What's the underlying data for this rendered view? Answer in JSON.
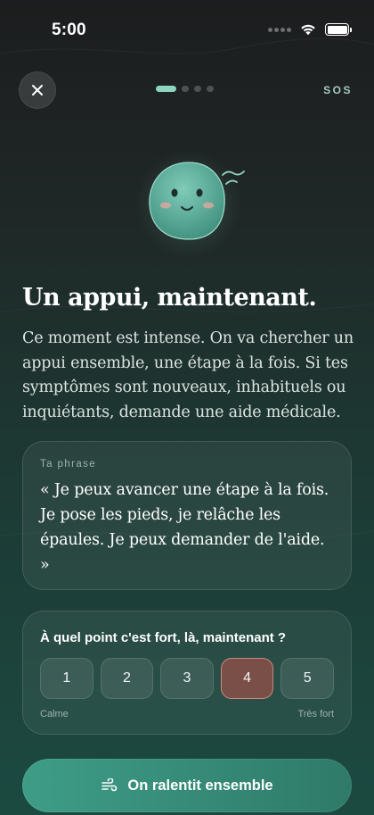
{
  "status_bar": {
    "time": "5:00"
  },
  "top_nav": {
    "close_icon": "close-icon",
    "progress_total": 4,
    "progress_current": 1,
    "sos_label": "SOS"
  },
  "mascot": {
    "icon": "smiling-blob-mascot",
    "color": "#5fae9c"
  },
  "content": {
    "title": "Un appui, maintenant.",
    "intro": "Ce moment est intense. On va chercher un appui ensemble, une étape à la fois. Si tes symptômes sont nouveaux, inhabituels ou inquiétants, demande une aide médicale."
  },
  "phrase_card": {
    "label": "Ta phrase",
    "text": "« Je peux avancer une étape à la fois. Je pose les pieds, je relâche les épaules. Je peux demander de l'aide. »"
  },
  "rating_card": {
    "question": "À quel point c'est fort, là, maintenant ?",
    "options": [
      "1",
      "2",
      "3",
      "4",
      "5"
    ],
    "selected": "4",
    "min_label": "Calme",
    "max_label": "Très fort"
  },
  "cta": {
    "icon": "wind-icon",
    "label": "On ralentit ensemble"
  },
  "colors": {
    "accent": "#8fd4c0",
    "selected_rating": "#7a4f47",
    "cta_start": "#3e9d87",
    "cta_end": "#2f7a69"
  }
}
